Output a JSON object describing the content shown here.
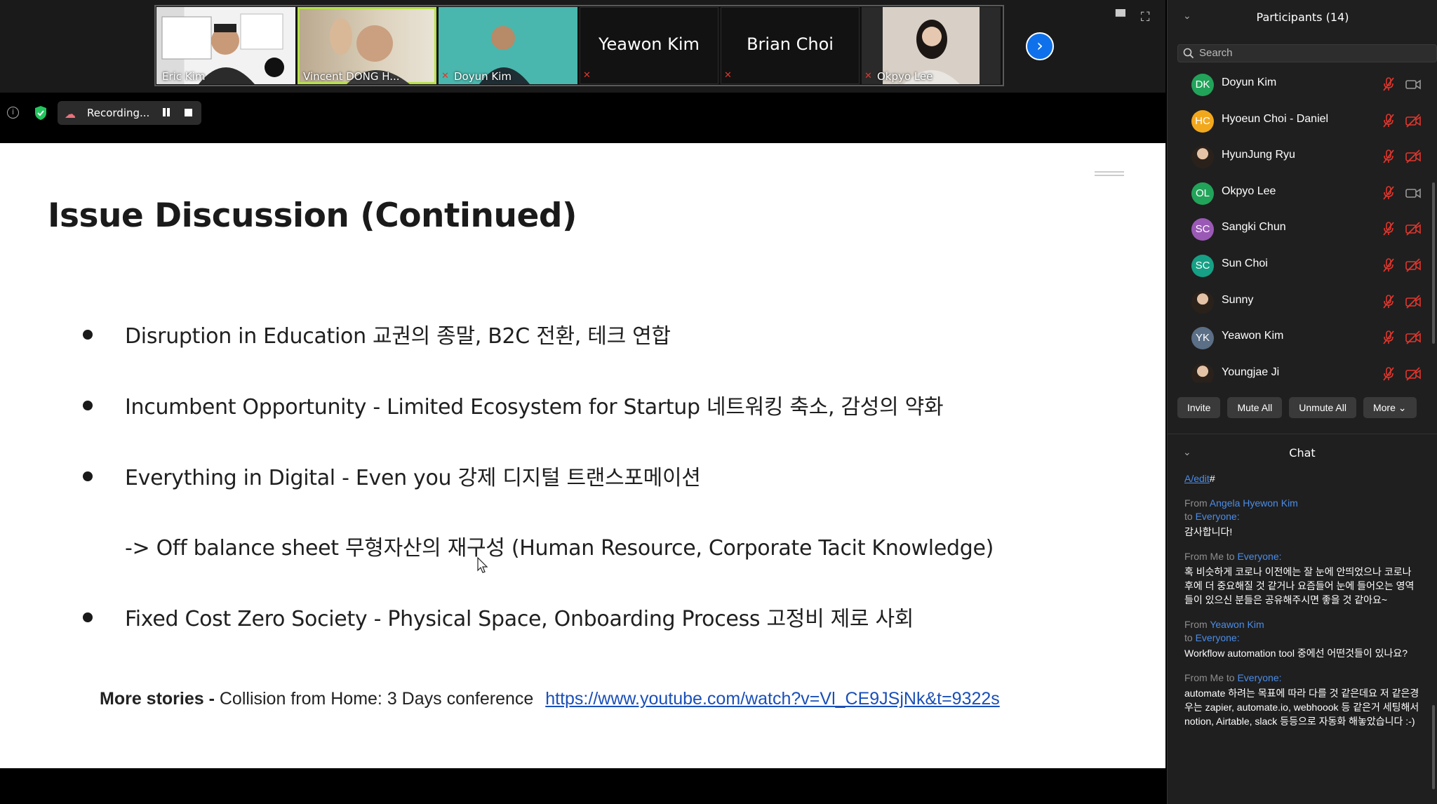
{
  "gallery": {
    "tiles": [
      {
        "name": "Eric Kim",
        "muted": false,
        "kind": "video",
        "active": false
      },
      {
        "name": "Vincent DONG H...",
        "muted": false,
        "kind": "video",
        "active": true
      },
      {
        "name": "Doyun Kim",
        "muted": true,
        "kind": "video",
        "active": false
      },
      {
        "name": "Yeawon Kim",
        "muted": true,
        "kind": "name",
        "active": false
      },
      {
        "name": "Brian Choi",
        "muted": true,
        "kind": "name",
        "active": false
      },
      {
        "name": "Okpyo Lee",
        "muted": true,
        "kind": "video",
        "active": false
      }
    ]
  },
  "recording": {
    "label": "Recording..."
  },
  "slide": {
    "title": "Issue Discussion (Continued)",
    "bullets": [
      "Disruption in Education 교권의 종말, B2C 전환, 테크 연합",
      "Incumbent Opportunity - Limited Ecosystem for Startup 네트워킹 축소, 감성의 약화",
      "Everything in Digital - Even you 강제 디지털 트랜스포메이션",
      "Fixed Cost Zero Society - Physical Space, Onboarding Process 고정비 제로 사회"
    ],
    "sub_line": "->  Off balance sheet 무형자산의 재구성 (Human Resource, Corporate Tacit Knowledge)",
    "more_label": "More stories - ",
    "more_text": "Collision from Home: 3 Days conference",
    "more_link": "https://www.youtube.com/watch?v=Vl_CE9JSjNk&t=9322s"
  },
  "participants": {
    "title": "Participants (14)",
    "search_placeholder": "Search",
    "list": [
      {
        "name": "Doyun Kim",
        "initials": "DK",
        "color": "#22a35a",
        "photo": false,
        "cam_off": false
      },
      {
        "name": "Hyoeun Choi - Daniel",
        "initials": "HC",
        "color": "#f2a81d",
        "photo": false,
        "cam_off": true
      },
      {
        "name": "HyunJung Ryu",
        "initials": "",
        "color": "#6b5a4a",
        "photo": true,
        "cam_off": true
      },
      {
        "name": "Okpyo Lee",
        "initials": "OL",
        "color": "#22a35a",
        "photo": false,
        "cam_off": false
      },
      {
        "name": "Sangki Chun",
        "initials": "SC",
        "color": "#9b59b6",
        "photo": false,
        "cam_off": true
      },
      {
        "name": "Sun Choi",
        "initials": "SC",
        "color": "#16a085",
        "photo": false,
        "cam_off": true
      },
      {
        "name": "Sunny",
        "initials": "",
        "color": "#6b4a5a",
        "photo": true,
        "cam_off": true
      },
      {
        "name": "Yeawon Kim",
        "initials": "YK",
        "color": "#5b6f86",
        "photo": false,
        "cam_off": true
      },
      {
        "name": "Youngjae Ji",
        "initials": "",
        "color": "#3a2e26",
        "photo": true,
        "cam_off": true
      }
    ],
    "buttons": {
      "invite": "Invite",
      "mute_all": "Mute All",
      "unmute_all": "Unmute All",
      "more": "More"
    }
  },
  "chat": {
    "title": "Chat",
    "top_fragment_link": "A/edit",
    "top_fragment_rest": "#",
    "messages": [
      {
        "from_prefix": "From ",
        "from": "Angela Hyewon Kim",
        "to_prefix": "to ",
        "to": "Everyone:",
        "from_is_me": false,
        "text": "감사합니다!"
      },
      {
        "from_prefix": "From Me to ",
        "from": "",
        "to_prefix": "",
        "to": "Everyone:",
        "from_is_me": true,
        "text": "혹 비슷하게 코로나 이전에는 잘 눈에 안띄었으나 코로나 후에 더 중요해질 것 같거나 요즘들어 눈에 들어오는 영역들이 있으신 분들은 공유해주시면 좋을 것 같아요~"
      },
      {
        "from_prefix": "From ",
        "from": "Yeawon Kim",
        "to_prefix": " to ",
        "to": "Everyone:",
        "from_is_me": false,
        "text": "Workflow automation tool 중에선 어떤것들이 있나요?"
      },
      {
        "from_prefix": "From Me to ",
        "from": "",
        "to_prefix": "",
        "to": "Everyone:",
        "from_is_me": true,
        "text": "automate 하려는 목표에 따라 다를 것 같은데요 저 같은경우는 zapier, automate.io, webhoook 등 같은거 세팅해서 notion, Airtable, slack 등등으로 자동화 해놓았습니다 :-)"
      }
    ]
  }
}
